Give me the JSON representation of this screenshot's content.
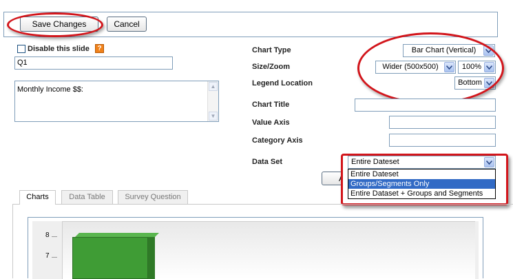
{
  "toolbar": {
    "save_label": "Save Changes",
    "cancel_label": "Cancel"
  },
  "slide": {
    "disable_label": "Disable this slide",
    "name_value": "Q1",
    "description_value": "Monthly Income $$:"
  },
  "settings": {
    "chart_type_label": "Chart Type",
    "chart_type_value": "Bar Chart (Vertical)",
    "size_zoom_label": "Size/Zoom",
    "size_value": "Wider (500x500)",
    "zoom_value": "100%",
    "legend_label": "Legend Location",
    "legend_value": "Bottom",
    "chart_title_label": "Chart Title",
    "chart_title_value": "",
    "value_axis_label": "Value Axis",
    "value_axis_value": "",
    "category_axis_label": "Category Axis",
    "category_axis_value": "",
    "data_set_label": "Data Set",
    "data_set_value": "Entire Dateset",
    "data_set_options": [
      "Entire Dateset",
      "Groups/Segments Only",
      "Entire Dataset + Groups and Segments"
    ],
    "apply_partial": "Ap"
  },
  "tabs": [
    {
      "label": "Charts",
      "active": true
    },
    {
      "label": "Data Table",
      "active": false
    },
    {
      "label": "Survey Question",
      "active": false
    }
  ],
  "preview": {
    "ticks": [
      "8",
      "7"
    ],
    "bar_color": "#3f9c35"
  },
  "colors": {
    "highlight": "#d2151b",
    "selection": "#316ac5",
    "field_border": "#7f9db9"
  }
}
